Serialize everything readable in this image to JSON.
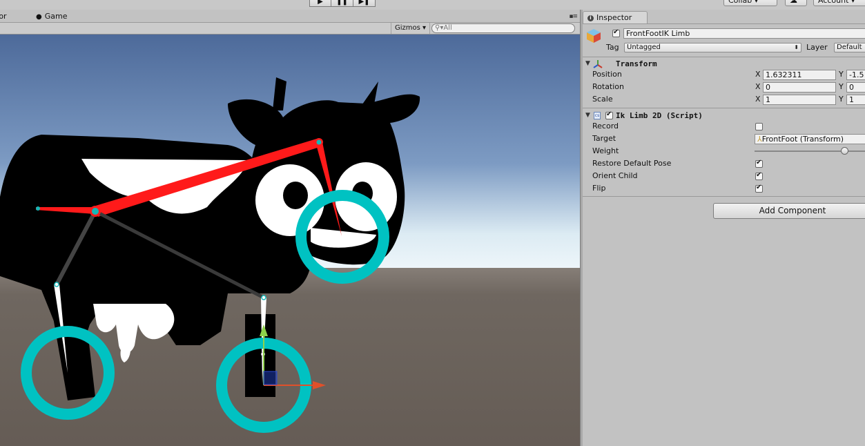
{
  "toolbar": {
    "play_icon": "▶",
    "pause_icon": "❚❚",
    "step_icon": "▶❚",
    "collab_label": "Collab ▾",
    "account_label": "Account ▾"
  },
  "scene": {
    "tab_scene_label": "tor",
    "tab_game_label": "Game",
    "gizmos_label": "Gizmos ▾",
    "search_placeholder": "All"
  },
  "inspector": {
    "tab_label": "Inspector",
    "object": {
      "enabled": true,
      "name": "FrontFootIK Limb",
      "tag_label": "Tag",
      "tag_value": "Untagged",
      "layer_label": "Layer",
      "layer_value": "Default"
    },
    "transform": {
      "title": "Transform",
      "position_label": "Position",
      "rotation_label": "Rotation",
      "scale_label": "Scale",
      "x_label": "X",
      "y_label": "Y",
      "position_x": "1.632311",
      "position_y": "-1.5",
      "rotation_x": "0",
      "rotation_y": "0",
      "scale_x": "1",
      "scale_y": "1"
    },
    "ik_limb": {
      "title": "Ik Limb 2D (Script)",
      "script_icon": "cs",
      "enabled": true,
      "record_label": "Record",
      "record": false,
      "target_label": "Target",
      "target_value": "FrontFoot (Transform)",
      "weight_label": "Weight",
      "weight": 0.77,
      "restore_label": "Restore Default Pose",
      "restore": true,
      "orient_label": "Orient Child",
      "orient": true,
      "flip_label": "Flip",
      "flip": true
    },
    "add_component_label": "Add Component"
  },
  "colors": {
    "ik_circle": "#00c2c2",
    "bone_red": "#ff1a1a",
    "sky_top": "#4d6a9a",
    "ground": "#6a6059"
  }
}
